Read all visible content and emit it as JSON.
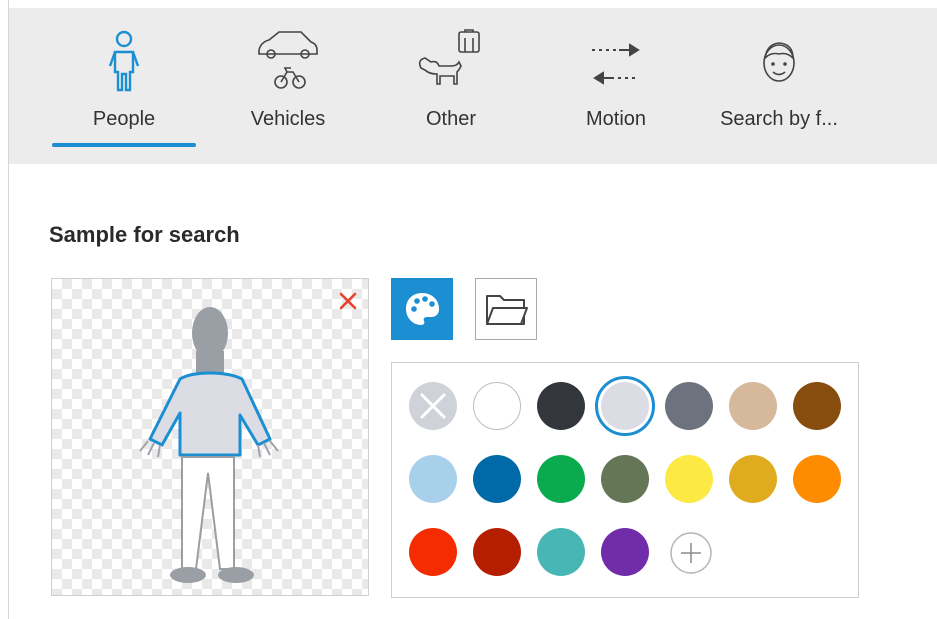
{
  "tabs": [
    {
      "label": "People",
      "icon": "person-icon",
      "active": true
    },
    {
      "label": "Vehicles",
      "icon": "vehicles-icon",
      "active": false
    },
    {
      "label": "Other",
      "icon": "dog-luggage-icon",
      "active": false
    },
    {
      "label": "Motion",
      "icon": "motion-arrows-icon",
      "active": false
    },
    {
      "label": "Search by f...",
      "icon": "face-icon",
      "active": false
    }
  ],
  "sample": {
    "title": "Sample for search",
    "remove_icon": "close-icon",
    "figure_icon": "person-figure-icon"
  },
  "modes": {
    "palette_icon": "palette-icon",
    "folder_icon": "folder-icon"
  },
  "colors": {
    "accent": "#1b8fd2",
    "remove": "#e8412c",
    "swatches": [
      "#cfd2d8",
      "#ffffff",
      "#33363d",
      "#dcdde4",
      "#6c737e",
      "#d6b89b",
      "#874d0f",
      "#a8d0ea",
      "#0069a8",
      "#0aaa4e",
      "#657656",
      "#fde943",
      "#e0ac1f",
      "#ff8c00",
      "#f42c00",
      "#b51e00",
      "#47b6b5",
      "#712da9"
    ],
    "selected_index": 3
  },
  "add_color_icon": "plus-circle-icon"
}
